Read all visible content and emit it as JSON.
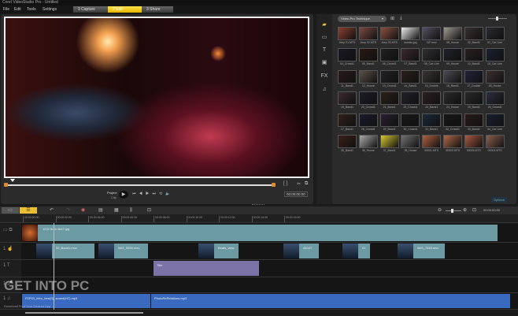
{
  "app": {
    "title": "Corel VideoStudio Pro - Untitled"
  },
  "menu": [
    "File",
    "Edit",
    "Tools",
    "Settings"
  ],
  "steps": [
    {
      "label": "1  Capture",
      "active": false
    },
    {
      "label": "2  Edit",
      "active": true
    },
    {
      "label": "3  Share",
      "active": false
    }
  ],
  "preview": {
    "mode_project": "Project",
    "mode_clip": "Clip",
    "timecode": "00:00:00:00",
    "controls": [
      "home",
      "prev-frame",
      "play",
      "next-frame",
      "end",
      "repeat",
      "volume"
    ]
  },
  "library": {
    "dropdown": "Video-Pro Technique",
    "options_label": "Options",
    "categories": [
      "media",
      "transition",
      "title",
      "graphic",
      "FX",
      "audio"
    ],
    "items": [
      {
        "label": "Jeep 01.MTS",
        "color": "#8a4030"
      },
      {
        "label": "Jeep 02.MTS",
        "color": "#7a4a40"
      },
      {
        "label": "Jeep 03.MTS",
        "color": "#8a5040"
      },
      {
        "label": "tomato.jpg",
        "color": "#eeeeee"
      },
      {
        "label": "11F.mov",
        "color": "#555060"
      },
      {
        "label": "08_House",
        "color": "#a09a90"
      },
      {
        "label": "02_Band1",
        "color": "#3a3030"
      },
      {
        "label": "01_Car Line",
        "color": "#2a2a30"
      },
      {
        "label": "04_Crowd1",
        "color": "#1a1a22"
      },
      {
        "label": "05_Band1",
        "color": "#2a1812"
      },
      {
        "label": "06_Crowd1",
        "color": "#202020"
      },
      {
        "label": "07_Band1",
        "color": "#3a2a30"
      },
      {
        "label": "08_Car Line",
        "color": "#303035"
      },
      {
        "label": "09_House",
        "color": "#20202a"
      },
      {
        "label": "10_Band1",
        "color": "#2a2020"
      },
      {
        "label": "10_Car Line",
        "color": "#1a2030"
      },
      {
        "label": "11_Band1",
        "color": "#2a1a18"
      },
      {
        "label": "12_House",
        "color": "#5a5048"
      },
      {
        "label": "13_Crowd1",
        "color": "#222226"
      },
      {
        "label": "14_Band1",
        "color": "#2a201a"
      },
      {
        "label": "15_Double",
        "color": "#3a3432"
      },
      {
        "label": "16_Band1",
        "color": "#4a4a50"
      },
      {
        "label": "17_Double",
        "color": "#20223a"
      },
      {
        "label": "18_House",
        "color": "#3a3030"
      },
      {
        "label": "19_Band1",
        "color": "#3a2a30"
      },
      {
        "label": "20_Crowd1",
        "color": "#1c1c26"
      },
      {
        "label": "21_Band1",
        "color": "#2a2018"
      },
      {
        "label": "22_Crowd1",
        "color": "#20202a"
      },
      {
        "label": "23_Band1",
        "color": "#2a2220"
      },
      {
        "label": "24_House",
        "color": "#2a2a2a"
      },
      {
        "label": "25_Band1",
        "color": "#28282a"
      },
      {
        "label": "26_Crowd1",
        "color": "#2a2e3a"
      },
      {
        "label": "27_Band1",
        "color": "#302018"
      },
      {
        "label": "28_Crowd1",
        "color": "#1a1c2a"
      },
      {
        "label": "29_Band1",
        "color": "#2a2030"
      },
      {
        "label": "30_Crowd1",
        "color": "#181818"
      },
      {
        "label": "31_Band1",
        "color": "#1a2a3a"
      },
      {
        "label": "32_Crowd1",
        "color": "#161616"
      },
      {
        "label": "33_Band1",
        "color": "#2a1a1a"
      },
      {
        "label": "34_Car Line",
        "color": "#1a2030"
      },
      {
        "label": "35_Band1",
        "color": "#3a2018"
      },
      {
        "label": "36_House",
        "color": "#aaaaaa"
      },
      {
        "label": "37_Band1",
        "color": "#d8c830"
      },
      {
        "label": "38_House",
        "color": "#707070"
      },
      {
        "label": "00001.MTS",
        "color": "#b06040"
      },
      {
        "label": "00002.MTS",
        "color": "#b06848"
      },
      {
        "label": "00003.MTS",
        "color": "#a85a40"
      },
      {
        "label": "00004.MTS",
        "color": "#8a6050"
      }
    ]
  },
  "timeline": {
    "ruler": [
      "00:00:00:00",
      "00:00:02:00",
      "00:00:04:00",
      "00:00:06:00",
      "00:00:08:00",
      "00:00:10:00",
      "00:00:12:00",
      "00:00:14:00",
      "00:00:16:00"
    ],
    "video_track": [
      {
        "label": "1232 fb4b 4b47.jpg"
      }
    ],
    "overlay_track": [
      {
        "label": "32_Band1.mov"
      },
      {
        "label": "IMG_5094.mov"
      },
      {
        "label": "Boats_view"
      },
      {
        "label": "4404T"
      },
      {
        "label": "01"
      },
      {
        "label": "IMG_7048.mov"
      }
    ],
    "title_track": [
      {
        "label": "Title"
      }
    ],
    "music_track": [
      {
        "label": "P2P03_intro_bee(S)_sound(HT).mp3"
      },
      {
        "label": "PhotoReRelations.mp3"
      }
    ]
  },
  "watermark": {
    "text": "GET INTO PC",
    "subtitle": "Download Free Your Desired App"
  }
}
